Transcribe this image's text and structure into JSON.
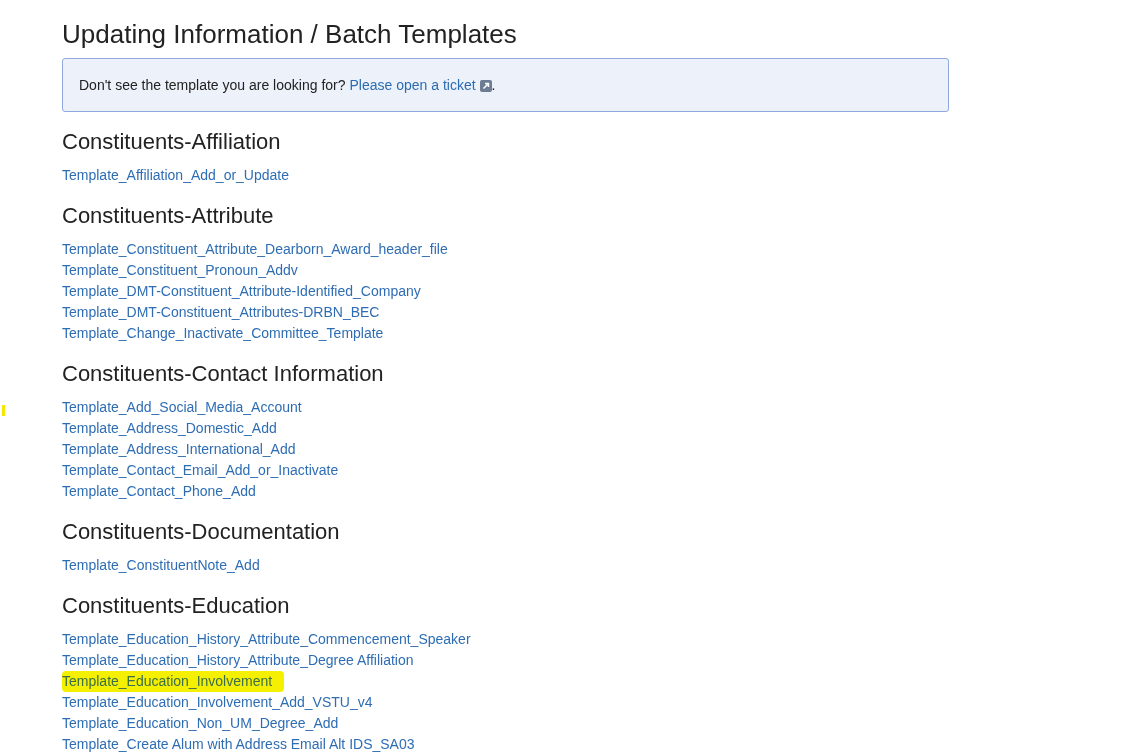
{
  "title": "Updating Information / Batch Templates",
  "notice": {
    "text": "Don't see the template you are looking for?",
    "link": "Please open a ticket",
    "end": "."
  },
  "sections": [
    {
      "heading": "Constituents-Affiliation",
      "links": [
        {
          "label": "Template_Affiliation_Add_or_Update",
          "highlighted": false
        }
      ]
    },
    {
      "heading": "Constituents-Attribute",
      "links": [
        {
          "label": "Template_Constituent_Attribute_Dearborn_Award_header_file",
          "highlighted": false
        },
        {
          "label": "Template_Constituent_Pronoun_Addv",
          "highlighted": false
        },
        {
          "label": "Template_DMT-Constituent_Attribute-Identified_Company",
          "highlighted": false
        },
        {
          "label": "Template_DMT-Constituent_Attributes-DRBN_BEC",
          "highlighted": false
        },
        {
          "label": "Template_Change_Inactivate_Committee_Template",
          "highlighted": false
        }
      ]
    },
    {
      "heading": "Constituents-Contact Information",
      "links": [
        {
          "label": "Template_Add_Social_Media_Account",
          "highlighted": false
        },
        {
          "label": "Template_Address_Domestic_Add",
          "highlighted": false
        },
        {
          "label": "Template_Address_International_Add",
          "highlighted": false
        },
        {
          "label": "Template_Contact_Email_Add_or_Inactivate",
          "highlighted": false
        },
        {
          "label": "Template_Contact_Phone_Add",
          "highlighted": false
        }
      ]
    },
    {
      "heading": "Constituents-Documentation",
      "links": [
        {
          "label": "Template_ConstituentNote_Add",
          "highlighted": false
        }
      ]
    },
    {
      "heading": "Constituents-Education",
      "links": [
        {
          "label": "Template_Education_History_Attribute_Commencement_Speaker",
          "highlighted": false
        },
        {
          "label": "Template_Education_History_Attribute_Degree Affiliation",
          "highlighted": false
        },
        {
          "label": "Template_Education_Involvement",
          "highlighted": true
        },
        {
          "label": "Template_Education_Involvement_Add_VSTU_v4",
          "highlighted": false
        },
        {
          "label": "Template_Education_Non_UM_Degree_Add",
          "highlighted": false
        },
        {
          "label": "Template_Create Alum with Address Email Alt IDS_SA03",
          "highlighted": false
        }
      ]
    }
  ]
}
